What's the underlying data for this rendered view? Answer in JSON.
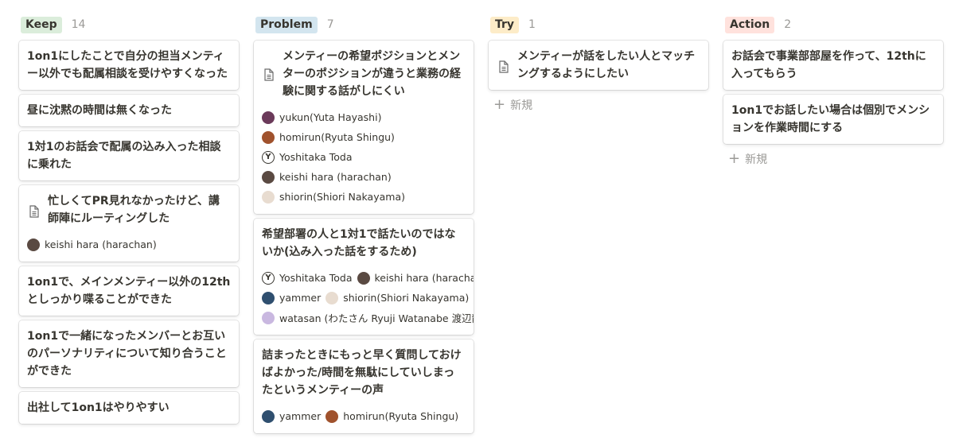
{
  "columns": [
    {
      "label": "Keep",
      "count": "14",
      "tag_color": "#dbeddb",
      "cards": [
        {
          "title": "1on1にしたことで自分の担当メンティー以外でも配属相談を受けやすくなった"
        },
        {
          "title": "昼に沈黙の時間は無くなった"
        },
        {
          "title": "1対1のお話会で配属の込み入った相談に乗れた"
        },
        {
          "title": "忙しくてPR見れなかったけど、講師陣にルーティングした",
          "icon": "document-icon"
        },
        {
          "title": "1on1で、メインメンティー以外の12thとしっかり喋ることができた"
        },
        {
          "title": "1on1で一緒になったメンバーとお互いのパーソナリティについて知り合うことができた"
        },
        {
          "title": "出社して1on1はやりやすい"
        }
      ],
      "people_card_3": [
        [
          "keishi hara (harachan)"
        ]
      ]
    },
    {
      "label": "Problem",
      "count": "7",
      "tag_color": "#d3e5ef",
      "cards": [
        {
          "title": "メンティーの希望ポジションとメンターのポジションが違うと業務の経験に関する話がしにくい",
          "icon": "document-icon"
        },
        {
          "title": "希望部署の人と1対1で話たいのではないか(込み入った話をするため)"
        },
        {
          "title": "詰まったときにもっと早く質問しておけばよかった/時間を無駄にしていしまったというメンティーの声"
        }
      ],
      "people_card_0": [
        [
          "yukun(Yuta Hayashi)"
        ],
        [
          "homirun(Ryuta Shingu)"
        ],
        [
          "Yoshitaka Toda"
        ],
        [
          "keishi hara (harachan)"
        ],
        [
          "shiorin(Shiori Nakayama)"
        ]
      ],
      "people_card_1": [
        [
          "Yoshitaka Toda",
          "keishi hara (harachan)"
        ],
        [
          "yammer",
          "shiorin(Shiori Nakayama)"
        ],
        [
          "watasan (わたさん Ryuji Watanabe 渡辺龍二)"
        ]
      ],
      "people_card_2": [
        [
          "yammer",
          "homirun(Ryuta Shingu)"
        ]
      ]
    },
    {
      "label": "Try",
      "count": "1",
      "tag_color": "#fdecc8",
      "cards": [
        {
          "title": "メンティーが話をしたい人とマッチングするようにしたい",
          "icon": "document-icon"
        }
      ],
      "new_label": "新規"
    },
    {
      "label": "Action",
      "count": "2",
      "tag_color": "#ffe2dd",
      "cards": [
        {
          "title": "お話会で事業部部屋を作って、12thに入ってもらう"
        },
        {
          "title": "1on1でお話したい場合は個別でメンションを作業時間にする"
        }
      ],
      "new_label": "新規"
    }
  ],
  "avatar_colors": {
    "keishi hara (harachan)": "#5a4a42",
    "yukun(Yuta Hayashi)": "#6b3a5a",
    "homirun(Ryuta Shingu)": "#a0522d",
    "shiorin(Shiori Nakayama)": "#e8dcd0",
    "yammer": "#2f4f6f",
    "watasan (わたさん Ryuji Watanabe 渡辺龍二)": "#c9b8e0"
  },
  "avatar_glyph_yoshitaka": "Y"
}
